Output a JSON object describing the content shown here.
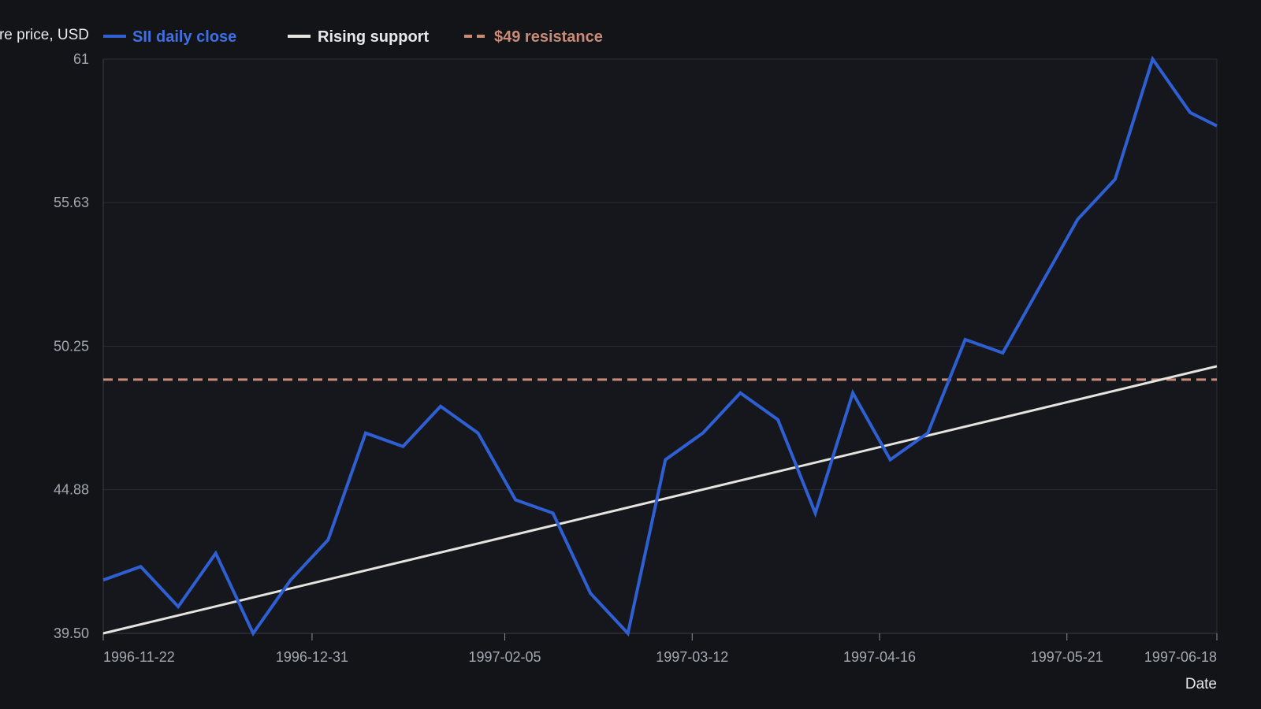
{
  "chart_data": {
    "type": "line",
    "ylabel": "Share price, USD",
    "xlabel": "Date",
    "ylim": [
      39.5,
      61
    ],
    "xlim": [
      "1996-11-22",
      "1997-06-18"
    ],
    "y_ticks": [
      "39.50",
      "44.88",
      "50.25",
      "55.63",
      "61"
    ],
    "x_ticks": [
      "1996-11-22",
      "1996-12-31",
      "1997-02-05",
      "1997-03-12",
      "1997-04-16",
      "1997-05-21",
      "1997-06-18"
    ],
    "legend_position": "top-left",
    "grid": "horizontal",
    "series": [
      {
        "name": "SII daily close",
        "color": "#2e5fd3",
        "style": "solid",
        "x": [
          "1996-11-22",
          "1996-11-29",
          "1996-12-06",
          "1996-12-13",
          "1996-12-20",
          "1996-12-27",
          "1997-01-03",
          "1997-01-10",
          "1997-01-17",
          "1997-01-24",
          "1997-01-31",
          "1997-02-07",
          "1997-02-14",
          "1997-02-21",
          "1997-02-28",
          "1997-03-07",
          "1997-03-14",
          "1997-03-21",
          "1997-03-28",
          "1997-04-04",
          "1997-04-11",
          "1997-04-18",
          "1997-04-25",
          "1997-05-02",
          "1997-05-09",
          "1997-05-16",
          "1997-05-23",
          "1997-05-30",
          "1997-06-06",
          "1997-06-13",
          "1997-06-18"
        ],
        "y": [
          41.5,
          42.0,
          40.5,
          42.5,
          39.5,
          41.5,
          43.0,
          47.0,
          46.5,
          48.0,
          47.0,
          44.5,
          44.0,
          41.0,
          39.5,
          46.0,
          47.0,
          48.5,
          47.5,
          44.0,
          48.5,
          46.0,
          47.0,
          50.5,
          50.0,
          52.5,
          55.0,
          56.5,
          61.0,
          59.0,
          58.5
        ]
      },
      {
        "name": "Rising support",
        "color": "#e6e4df",
        "style": "solid",
        "x": [
          "1996-11-22",
          "1997-06-18"
        ],
        "y": [
          39.5,
          49.5
        ]
      },
      {
        "name": "$49 resistance",
        "color": "#c98b78",
        "style": "dashed",
        "x": [
          "1996-11-22",
          "1997-06-18"
        ],
        "y": [
          49.0,
          49.0
        ]
      }
    ]
  }
}
